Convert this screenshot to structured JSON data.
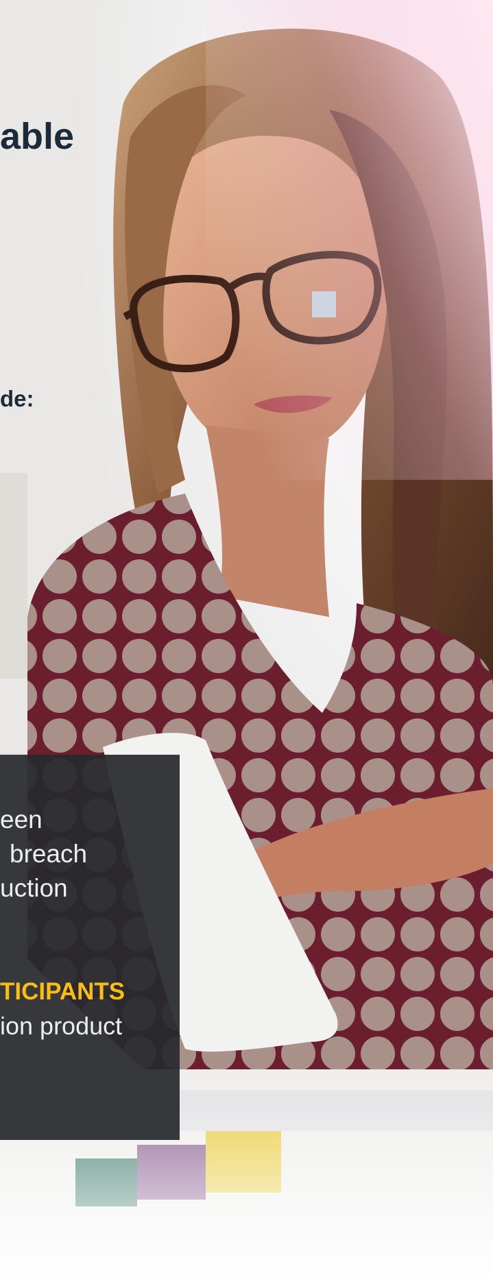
{
  "heading": {
    "fragment": "able"
  },
  "subheading": {
    "fragment": "de:"
  },
  "panel": {
    "lines": [
      "een",
      "breach",
      "uction"
    ],
    "highlight": "TICIPANTS",
    "trailing_line": "ion product"
  },
  "colors": {
    "heading_text": "#1c2a3a",
    "panel_background": "#28292d",
    "panel_text": "#eceef0",
    "highlight_text": "#fbbd13"
  }
}
